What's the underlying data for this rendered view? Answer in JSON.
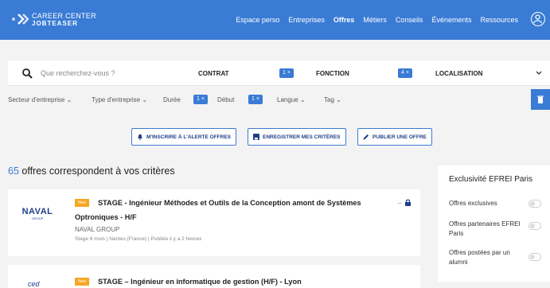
{
  "header": {
    "brand_line1": "CAREER CENTER",
    "brand_line2": "JOBTEASER",
    "nav": [
      "Espace perso",
      "Entreprises",
      "Offres",
      "Métiers",
      "Conseils",
      "Événements",
      "Ressources"
    ],
    "active_nav": "Offres"
  },
  "search": {
    "placeholder": "Que recherchez-vous ?",
    "contrat_label": "CONTRAT",
    "contrat_badge": "1 ×",
    "fonction_label": "FONCTION",
    "fonction_badge": "4 ×",
    "localisation_label": "LOCALISATION"
  },
  "filters": {
    "secteur": "Secteur d'entreprise",
    "type": "Type d'entreprise",
    "duree": "Durée",
    "duree_badge": "1 ×",
    "debut": "Début",
    "debut_badge": "1 ×",
    "langue": "Langue",
    "tag": "Tag"
  },
  "actions": {
    "alert": "M'INSCRIRE À L'ALERTE OFFRES",
    "save": "ENREGISTRER MES CRITÈRES",
    "publish": "PUBLIER UNE OFFRE"
  },
  "results": {
    "count": "65",
    "text": "offres correspondent à vos critères"
  },
  "offers": [
    {
      "tag": "New",
      "title_line1": "STAGE - Ingénieur Méthodes et Outils de la Conception amont de Systèmes",
      "title_line2": "Optroniques - H/F",
      "company": "NAVAL GROUP",
      "logo_text": "NAVAL",
      "logo_sub": "GROUP",
      "meta": "Stage 6 mois  |  Nantes (France)  |  Publiée il y a 2 heures"
    },
    {
      "tag": "New",
      "title_line1": "STAGE – Ingénieur en informatique de gestion (H/F) - Lyon",
      "logo_text": "ced"
    }
  ],
  "sidebar": {
    "title": "Exclusivité EFREI Paris",
    "options": [
      "Offres exclusives",
      "Offres partenaires EFREI Paris",
      "Offres postées par un alumni"
    ]
  },
  "colors": {
    "primary": "#3a7bd5",
    "new_tag": "#f6a623",
    "navy": "#1f3f8a"
  }
}
